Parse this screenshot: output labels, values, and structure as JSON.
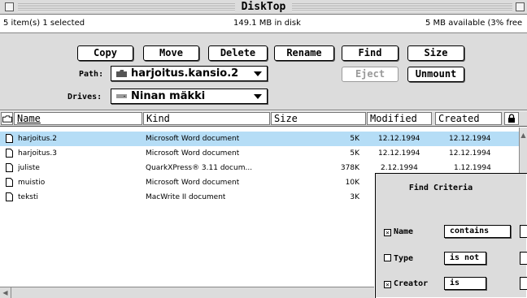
{
  "window": {
    "title": "DiskTop"
  },
  "infobar": {
    "items_selected": "5 item(s) 1 selected",
    "disk_used": "149.1 MB in disk",
    "available": "5 MB available  (3% free"
  },
  "toolbar": {
    "copy": "Copy",
    "move": "Move",
    "delete": "Delete",
    "rename": "Rename",
    "find": "Find",
    "size": "Size",
    "eject": "Eject",
    "unmount": "Unmount",
    "path_label": "Path:",
    "path_value": "harjoitus.kansio.2",
    "drives_label": "Drives:",
    "drives_value": "Ninan mäkki"
  },
  "columns": {
    "name": "Name",
    "kind": "Kind",
    "size": "Size",
    "modified": "Modified",
    "created": "Created"
  },
  "files": [
    {
      "name": "harjoitus.2",
      "kind": "Microsoft Word document",
      "size": "5K",
      "modified": "12.12.1994",
      "created": "12.12.1994"
    },
    {
      "name": "harjoitus.3",
      "kind": "Microsoft Word document",
      "size": "5K",
      "modified": "12.12.1994",
      "created": "12.12.1994"
    },
    {
      "name": "juliste",
      "kind": "QuarkXPress® 3.11 docum...",
      "size": "378K",
      "modified": "2.12.1994",
      "created": "1.12.1994"
    },
    {
      "name": "muistio",
      "kind": "Microsoft Word document",
      "size": "10K",
      "modified": "",
      "created": ""
    },
    {
      "name": "teksti",
      "kind": "MacWrite II document",
      "size": "3K",
      "modified": "",
      "created": ""
    }
  ],
  "find_dialog": {
    "title": "Find Criteria",
    "name_label": "Name",
    "name_checked": true,
    "name_op": "contains",
    "type_label": "Type",
    "type_checked": false,
    "type_op": "is not",
    "creator_label": "Creator",
    "creator_checked": true,
    "creator_op": "is"
  },
  "colors": {
    "chrome": "#dcdcdc",
    "selection": "#b5ddf6"
  }
}
